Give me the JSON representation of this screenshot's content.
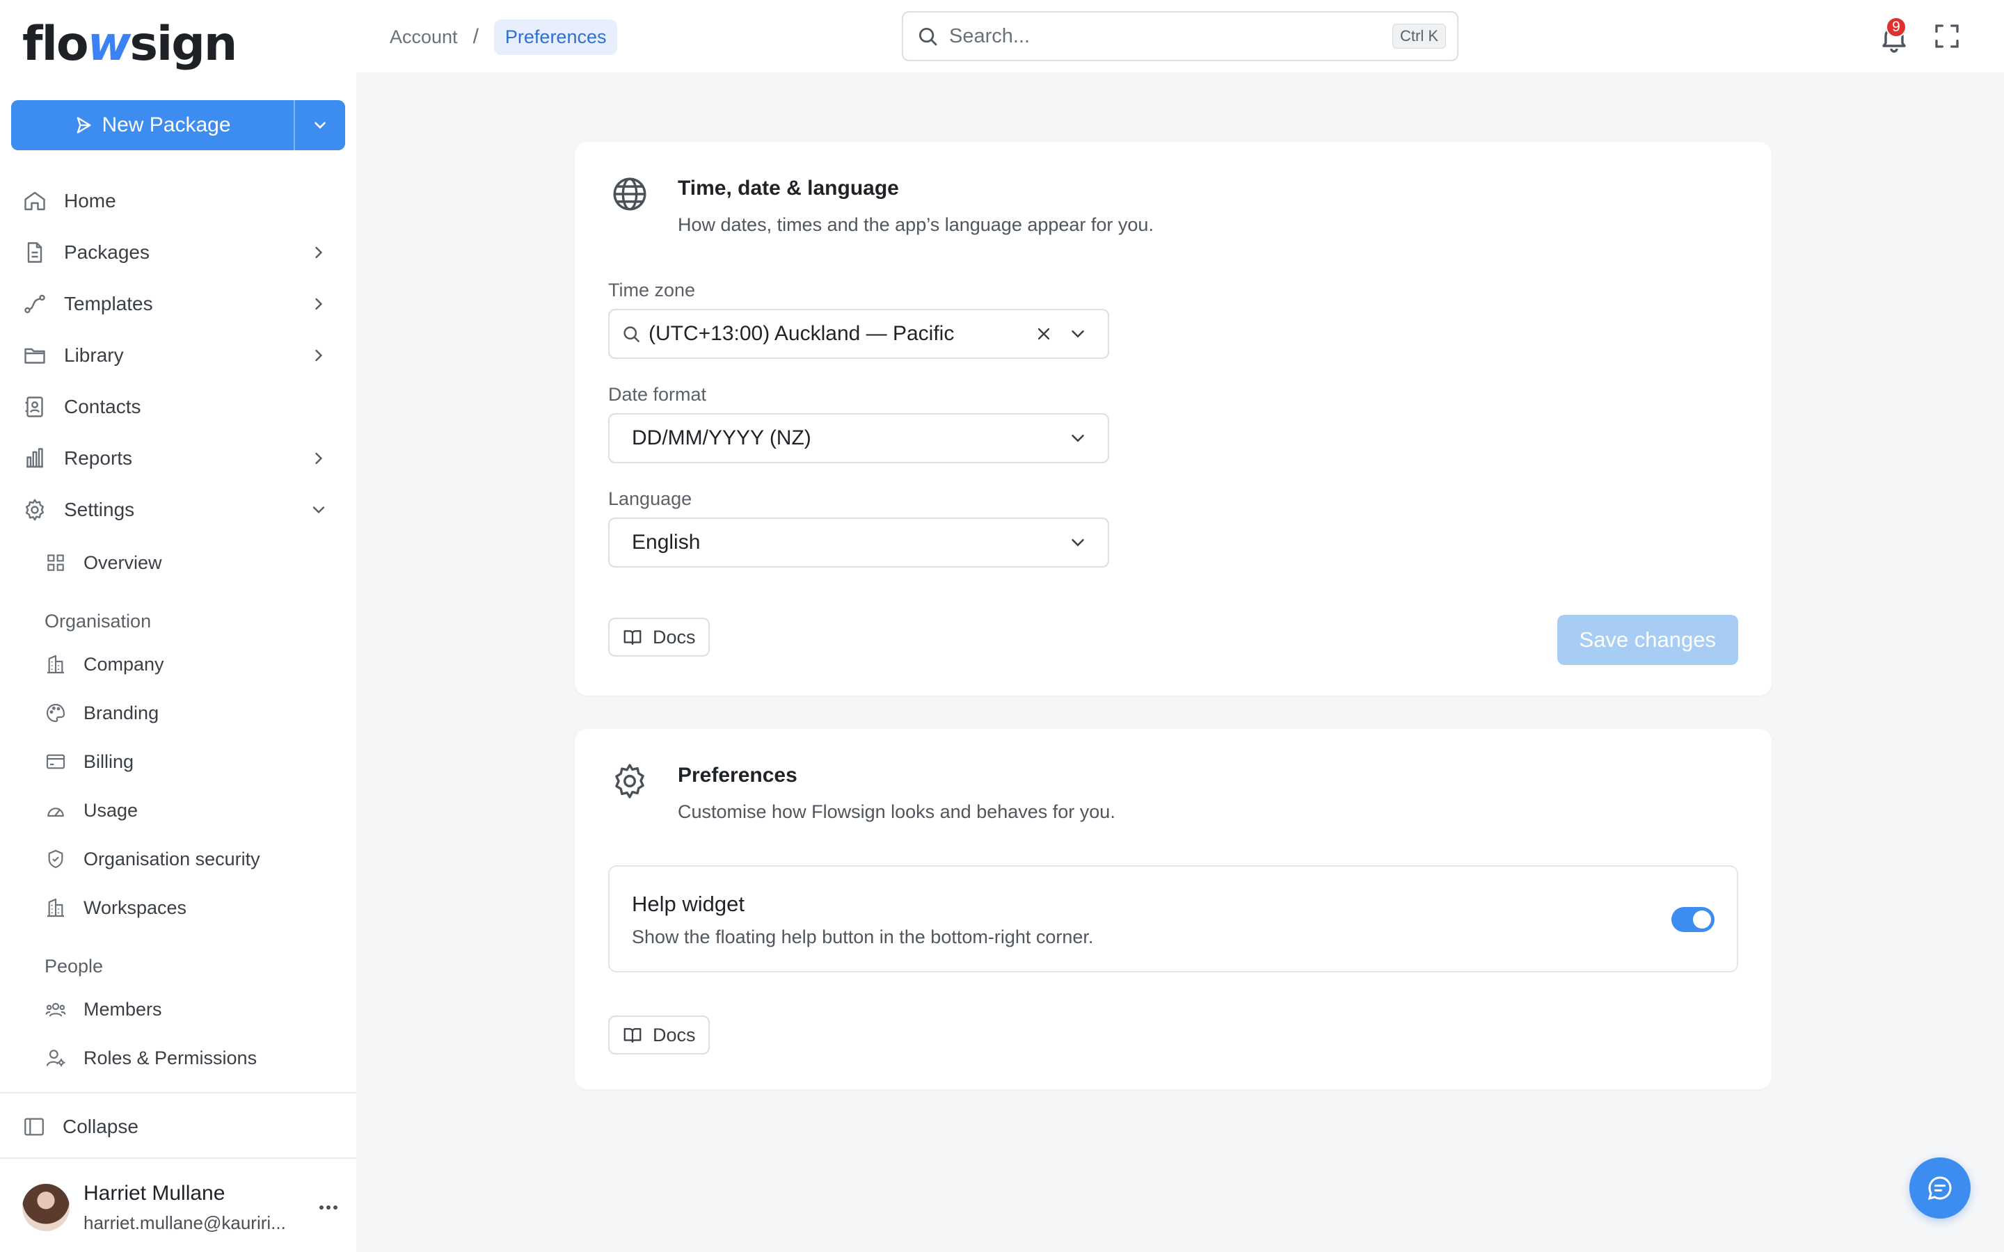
{
  "brand": {
    "logo_pre": "flo",
    "logo_mid": "w",
    "logo_post": "sign",
    "accent": "#3d8cf0"
  },
  "new_package": {
    "label": "New Package",
    "icon": "send-icon",
    "caret_icon": "chevron-down-icon"
  },
  "nav": {
    "home": "Home",
    "packages": "Packages",
    "templates": "Templates",
    "library": "Library",
    "contacts": "Contacts",
    "reports": "Reports",
    "settings": "Settings"
  },
  "settings_sub": {
    "overview": "Overview",
    "organisation_label": "Organisation",
    "company": "Company",
    "branding": "Branding",
    "billing": "Billing",
    "usage": "Usage",
    "org_security": "Organisation security",
    "workspaces": "Workspaces",
    "people_label": "People",
    "members": "Members",
    "roles": "Roles & Permissions"
  },
  "collapse": "Collapse",
  "user": {
    "name": "Harriet Mullane",
    "email": "harriet.mullane@kauriri..."
  },
  "breadcrumb": {
    "parent": "Account",
    "separator": "/",
    "current": "Preferences"
  },
  "search": {
    "placeholder": "Search...",
    "shortcut": "Ctrl K"
  },
  "notifications": {
    "count": "9"
  },
  "time_card": {
    "title": "Time, date & language",
    "subtitle": "How dates, times and the app’s language appear for you.",
    "timezone_label": "Time zone",
    "timezone_value": "(UTC+13:00) Auckland — Pacific",
    "date_label": "Date format",
    "date_value": "DD/MM/YYYY (NZ)",
    "language_label": "Language",
    "language_value": "English",
    "docs": "Docs",
    "save": "Save changes"
  },
  "prefs_card": {
    "title": "Preferences",
    "subtitle": "Customise how Flowsign looks and behaves for you.",
    "widget_title": "Help widget",
    "widget_desc": "Show the floating help button in the bottom-right corner.",
    "widget_enabled": true,
    "docs": "Docs"
  }
}
